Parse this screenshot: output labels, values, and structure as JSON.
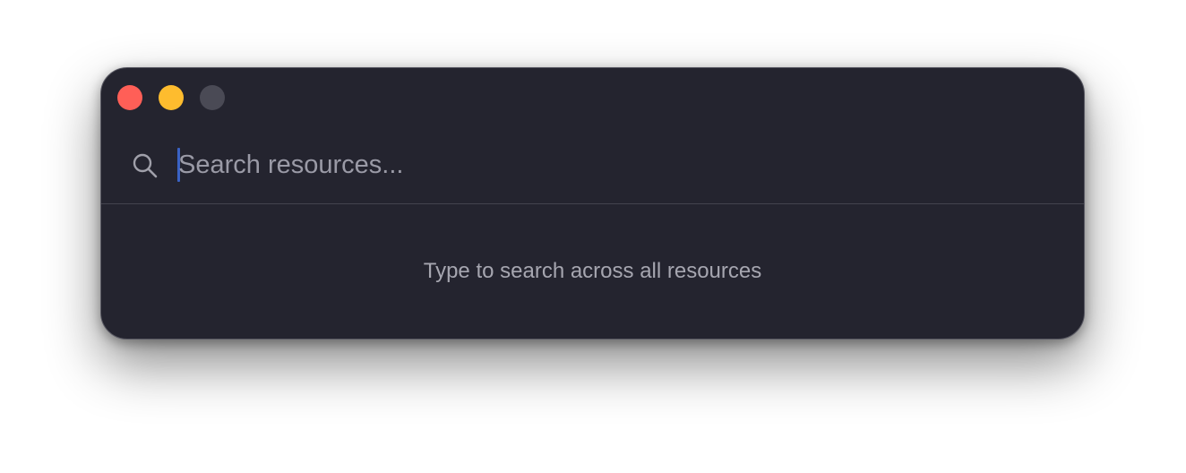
{
  "window": {
    "controls": {
      "close_icon": "close-dot",
      "minimize_icon": "minimize-dot",
      "zoom_icon": "zoom-dot",
      "colors": {
        "close": "#ff5f57",
        "minimize": "#febc2e",
        "zoom_disabled": "#4a4a55"
      }
    },
    "background_color": "#24242f"
  },
  "search": {
    "icon": "search-icon",
    "placeholder": "Search resources...",
    "value": "",
    "caret_color": "#3a62c4"
  },
  "results": {
    "empty_message": "Type to search across all resources"
  }
}
